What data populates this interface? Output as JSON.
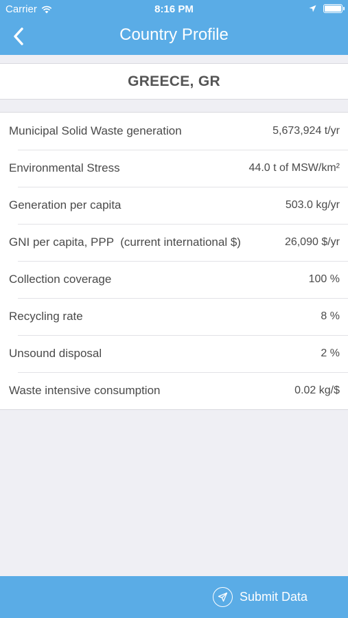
{
  "status_bar": {
    "carrier": "Carrier",
    "time": "8:16 PM",
    "icons": [
      "wifi-icon",
      "location-arrow-icon",
      "battery-icon"
    ]
  },
  "nav": {
    "title": "Country Profile",
    "back_icon": "chevron-left-icon"
  },
  "country": {
    "name": "GREECE, GR"
  },
  "metrics": [
    {
      "label": "Municipal Solid Waste generation",
      "value": "5,673,924 t/yr"
    },
    {
      "label": "Environmental Stress",
      "value": "44.0 t of MSW/km²"
    },
    {
      "label": "Generation per capita",
      "value": "503.0 kg/yr"
    },
    {
      "label": "GNI per capita, PPP  (current international $)",
      "value": "26,090 $/yr"
    },
    {
      "label": "Collection coverage",
      "value": "100 %"
    },
    {
      "label": "Recycling rate",
      "value": "8 %"
    },
    {
      "label": "Unsound disposal",
      "value": "2 %"
    },
    {
      "label": "Waste intensive consumption",
      "value": "0.02 kg/$"
    }
  ],
  "bottom": {
    "submit_label": "Submit Data",
    "submit_icon": "paper-plane-icon"
  },
  "colors": {
    "accent": "#5aace6",
    "background": "#efeff4",
    "text": "#4a4a4a"
  }
}
